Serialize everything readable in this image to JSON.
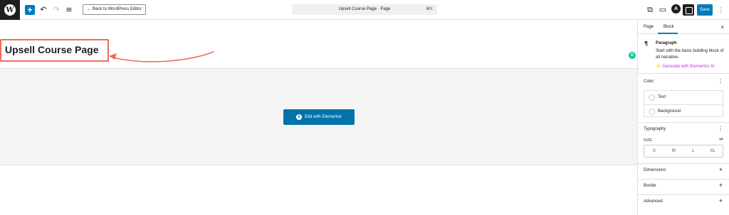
{
  "toolbar": {
    "wp_logo": "W",
    "add_icon": "+",
    "undo_icon": "↶",
    "redo_icon": "↷",
    "list_view_icon": "≡",
    "back_label": "← Back to WordPress Editor",
    "doc_title": "Upsell Course Page · Page",
    "doc_shortcut": "⌘K",
    "view_external_icon": "⧉",
    "preview_icon": "▭",
    "astra_icon": "A",
    "save_label": "Save",
    "more_icon": "⋮"
  },
  "canvas": {
    "page_title": "Upsell Course Page",
    "grammarly_icon": "G",
    "elementor_badge": "E",
    "elementor_button": "Edit with Elementor",
    "annotation_color": "#f06b5b"
  },
  "sidebar": {
    "tabs": {
      "page": "Page",
      "block": "Block"
    },
    "close_icon": "×",
    "block": {
      "icon": "¶",
      "name": "Paragraph",
      "description": "Start with the basic building block of all narrative.",
      "ai_link": "✨ Generate with Elementor AI"
    },
    "color": {
      "title": "Color",
      "menu_icon": "⋮",
      "items": [
        "Text",
        "Background"
      ]
    },
    "typography": {
      "title": "Typography",
      "menu_icon": "⋮",
      "size_label": "SIZE",
      "size_control_icon": "⇌",
      "sizes": [
        "S",
        "M",
        "L",
        "XL"
      ]
    },
    "dimensions": {
      "title": "Dimensions",
      "icon": "+"
    },
    "border": {
      "title": "Border",
      "icon": "+"
    },
    "advanced": {
      "title": "Advanced",
      "icon": "+"
    }
  },
  "colors": {
    "accent": "#007cba",
    "elementor": "#0073aa",
    "ai_link": "#c036d6",
    "grammarly": "#15c39a"
  }
}
